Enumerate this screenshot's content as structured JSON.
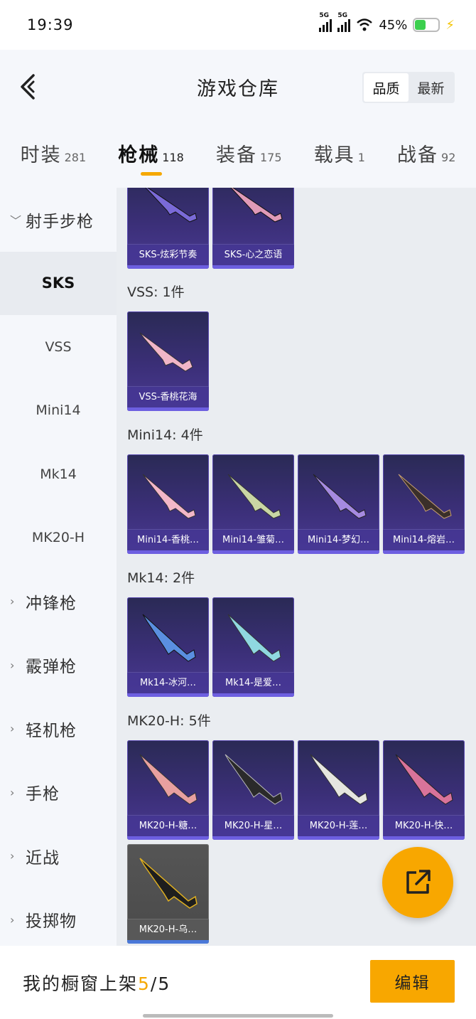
{
  "status_bar": {
    "time": "19:39",
    "signal1": "5G",
    "signal2": "5G",
    "battery_percent": "45%",
    "battery_level": 0.45
  },
  "header": {
    "title": "游戏仓库",
    "sort_options": [
      "品质",
      "最新"
    ],
    "sort_active": "品质"
  },
  "tabs": [
    {
      "label": "时装",
      "count": "281"
    },
    {
      "label": "枪械",
      "count": "118",
      "active": true
    },
    {
      "label": "装备",
      "count": "175"
    },
    {
      "label": "载具",
      "count": "1"
    },
    {
      "label": "战备",
      "count": "92"
    }
  ],
  "sidebar": {
    "items": [
      {
        "label": "射手步枪",
        "type": "category",
        "expanded": true
      },
      {
        "label": "SKS",
        "type": "sub",
        "selected": true
      },
      {
        "label": "VSS",
        "type": "sub"
      },
      {
        "label": "Mini14",
        "type": "sub"
      },
      {
        "label": "Mk14",
        "type": "sub"
      },
      {
        "label": "MK20-H",
        "type": "sub"
      },
      {
        "label": "冲锋枪",
        "type": "category"
      },
      {
        "label": "霰弹枪",
        "type": "category"
      },
      {
        "label": "轻机枪",
        "type": "category"
      },
      {
        "label": "手枪",
        "type": "category"
      },
      {
        "label": "近战",
        "type": "category"
      },
      {
        "label": "投掷物",
        "type": "category"
      }
    ]
  },
  "content": {
    "sks_items": [
      {
        "name": "SKS-炫彩节奏",
        "color": "#7a6ad8"
      },
      {
        "name": "SKS-心之恋语",
        "color": "#e09ab8"
      }
    ],
    "vss_label": "VSS: 1件",
    "vss_items": [
      {
        "name": "VSS-香桃花海",
        "color": "#f1b6c8"
      }
    ],
    "mini14_label": "Mini14: 4件",
    "mini14_items": [
      {
        "name": "Mini14-香桃…",
        "color": "#f3b7c8"
      },
      {
        "name": "Mini14-雏菊…",
        "color": "#c9d6a4"
      },
      {
        "name": "Mini14-梦幻…",
        "color": "#a58ae0"
      },
      {
        "name": "Mini14-熔岩…",
        "color": "#3a2f2a"
      }
    ],
    "mk14_label": "Mk14: 2件",
    "mk14_items": [
      {
        "name": "Mk14-冰河…",
        "color": "#5a8fe0"
      },
      {
        "name": "Mk14-是爱…",
        "color": "#8fd8e0"
      }
    ],
    "mk20_label": "MK20-H: 5件",
    "mk20_items": [
      {
        "name": "MK20-H-糖…",
        "color": "#e8a0a0"
      },
      {
        "name": "MK20-H-星…",
        "color": "#2a2a2a"
      },
      {
        "name": "MK20-H-莲…",
        "color": "#e6e6e0"
      },
      {
        "name": "MK20-H-快…",
        "color": "#d9739a"
      },
      {
        "name": "MK20-H-乌…",
        "color": "#1e1e1e",
        "gray": true
      }
    ]
  },
  "bottom_bar": {
    "showcase_prefix": "我的橱窗上架",
    "showcase_current": "5",
    "showcase_total": "/5",
    "edit_label": "编辑"
  },
  "colors": {
    "accent": "#f8a700",
    "card_bg": "#3b2f78"
  },
  "icons": {
    "back": "chevron-left-icon",
    "share": "external-share-icon"
  }
}
